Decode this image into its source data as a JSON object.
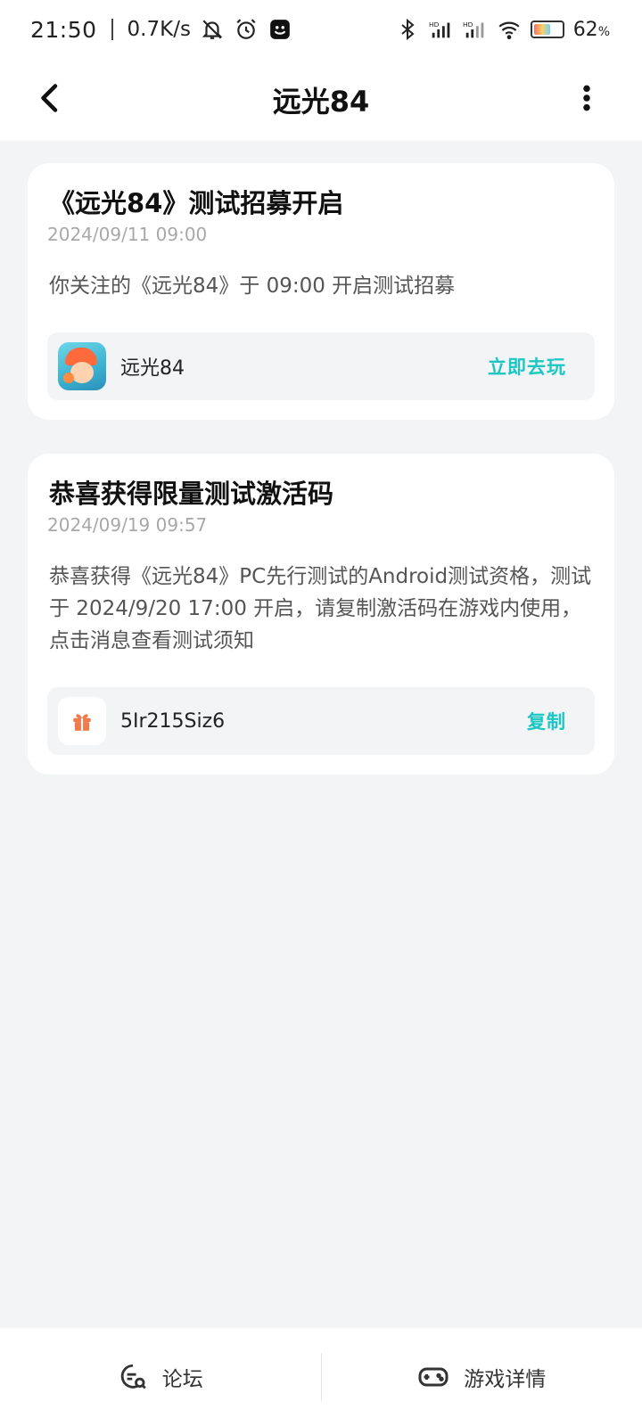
{
  "status_bar": {
    "time": "21:50",
    "net_speed": "0.7K/s",
    "battery_percent_text": "62",
    "battery_unit": "%",
    "battery_level": 0.62
  },
  "header": {
    "title": "远光84"
  },
  "cards": [
    {
      "title": "《远光84》测试招募开启",
      "date": "2024/09/11  09:00",
      "body": "你关注的《远光84》于 09:00 开启测试招募",
      "box_label": "远光84",
      "action": "立即去玩"
    },
    {
      "title": "恭喜获得限量测试激活码",
      "date": "2024/09/19  09:57",
      "body": "恭喜获得《远光84》PC先行测试的Android测试资格，测试于 2024/9/20 17:00 开启，请复制激活码在游戏内使用，点击消息查看测试须知",
      "box_label": "5Ir215Siz6",
      "action": "复制"
    }
  ],
  "bottom_bar": {
    "forum_label": "论坛",
    "details_label": "游戏详情"
  },
  "colors": {
    "accent": "#1cc7c3",
    "background": "#f3f4f6",
    "gift": "#f07a4a"
  },
  "icons": {
    "back": "chevron-left-icon",
    "more": "more-vertical-icon",
    "forum": "forum-search-icon",
    "details": "gamepad-icon",
    "gift": "gift-icon"
  }
}
